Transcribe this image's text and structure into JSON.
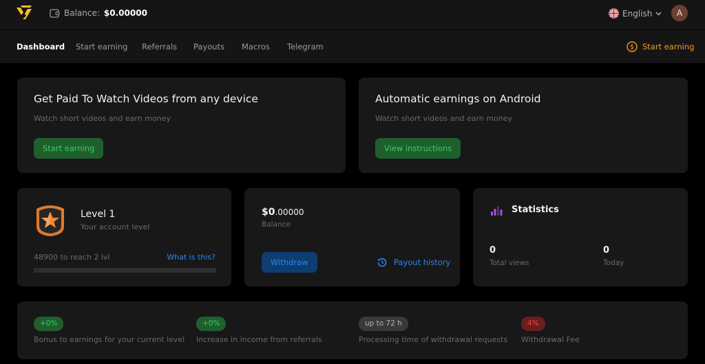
{
  "header": {
    "balance_label": "Balance:",
    "balance_value": "$0.00000",
    "language": "English",
    "avatar_initial": "A"
  },
  "nav": {
    "items": [
      {
        "label": "Dashboard",
        "active": true
      },
      {
        "label": "Start earning",
        "active": false
      },
      {
        "label": "Referrals",
        "active": false
      },
      {
        "label": "Payouts",
        "active": false
      },
      {
        "label": "Macros",
        "active": false
      },
      {
        "label": "Telegram",
        "active": false
      }
    ],
    "cta_label": "Start earning"
  },
  "promo_cards": [
    {
      "title": "Get Paid To Watch Videos from any device",
      "subtitle": "Watch short videos and earn money",
      "button": "Start earning"
    },
    {
      "title": "Automatic earnings on Android",
      "subtitle": "Watch short videos and earn money",
      "button": "View instructions"
    }
  ],
  "level": {
    "title": "Level 1",
    "subtitle": "Your account level",
    "progress_text": "48900 to reach 2 lvl",
    "help_link": "What is this?",
    "progress_fraction": 0
  },
  "balance_card": {
    "amount_int": "$0",
    "amount_dec": ".00000",
    "label": "Balance",
    "withdraw_button": "Withdraw",
    "history_link": "Payout history"
  },
  "statistics": {
    "title": "Statistics",
    "items": [
      {
        "value": "0",
        "label": "Total views"
      },
      {
        "value": "0",
        "label": "Today"
      }
    ]
  },
  "info": [
    {
      "badge": "+0%",
      "label": "Bonus to earnings for your current level",
      "color": "green"
    },
    {
      "badge": "+0%",
      "label": "Increase in income from referrals",
      "color": "green"
    },
    {
      "badge": "up to 72 h",
      "label": "Processing time of withdrawal requests",
      "color": "gray"
    },
    {
      "badge": "4%",
      "label": "Withdrawal Fee",
      "color": "red"
    }
  ],
  "colors": {
    "accent_orange": "#f59a23",
    "logo_yellow": "#f5c02a",
    "green": "#35d25a",
    "blue": "#2a86ee",
    "red": "#f04444",
    "purple": "#a64fe0"
  }
}
